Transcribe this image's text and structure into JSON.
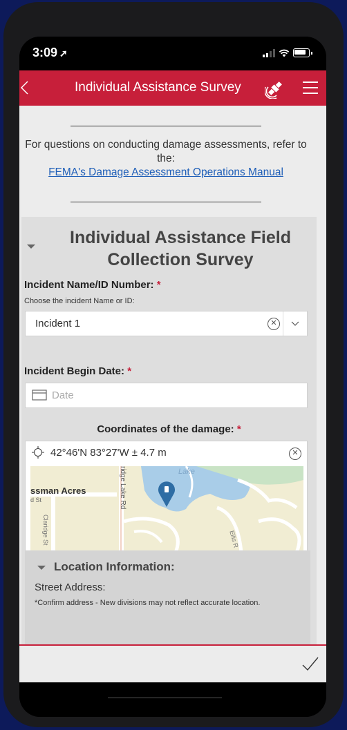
{
  "status": {
    "time": "3:09"
  },
  "header": {
    "title": "Individual Assistance Survey"
  },
  "intro": {
    "text": "For questions on conducting damage assessments, refer to the:",
    "link": "FEMA's Damage Assessment Operations Manual"
  },
  "survey": {
    "title": "Individual Assistance Field Collection Survey",
    "incident": {
      "label": "Incident Name/ID Number:",
      "required": "*",
      "hint": "Choose the incident Name or ID:",
      "value": "Incident 1"
    },
    "begin_date": {
      "label": "Incident Begin Date:",
      "required": "*",
      "placeholder": "Date"
    },
    "coordinates": {
      "label": "Coordinates of the damage:",
      "required": "*",
      "value": "42°46'N 83°27'W ± 4.7 m",
      "map_labels": {
        "place": "ssman Acres",
        "street1": "d St",
        "street2": "Claridge St",
        "road": "ridge Lake Rd",
        "lake": "Lake",
        "road2": "Ellis R"
      }
    },
    "location": {
      "title": "Location Information:",
      "street_label": "Street Address:",
      "note": "*Confirm address - New divisions may not reflect accurate location."
    }
  },
  "colors": {
    "accent": "#c71f3a",
    "link": "#1f5fb8",
    "pin": "#2e6da4"
  },
  "icons": [
    "back-arrow-icon",
    "satellite-icon",
    "menu-icon",
    "clear-icon",
    "chevron-down-icon",
    "calendar-icon",
    "crosshair-icon",
    "map-pin-icon",
    "checkmark-icon"
  ]
}
